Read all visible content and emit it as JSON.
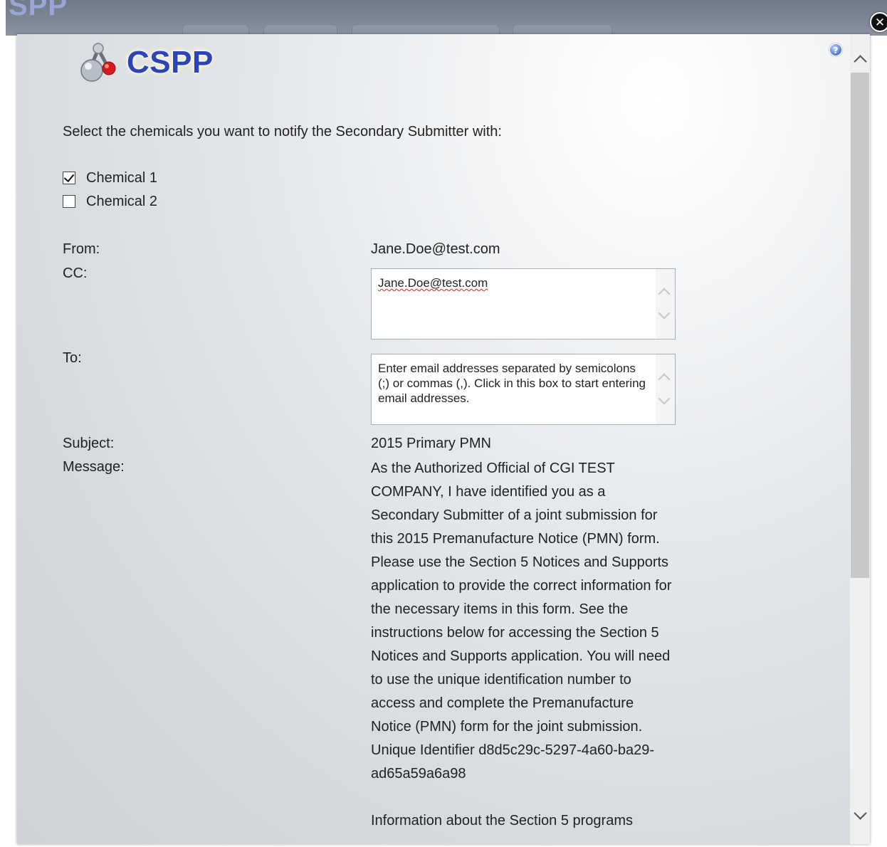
{
  "background_app": {
    "logo_text": "SPP"
  },
  "dialog": {
    "logo_text": "CSPP",
    "instruction": "Select the chemicals you want to notify the Secondary Submitter with:",
    "chemicals": [
      {
        "label": "Chemical 1",
        "checked": true
      },
      {
        "label": "Chemical 2",
        "checked": false
      }
    ],
    "from_label": "From:",
    "from_value": "Jane.Doe@test.com",
    "cc_label": "CC:",
    "cc_value": "Jane.Doe@test.com",
    "to_label": "To:",
    "to_placeholder": "Enter email addresses separated by semicolons (;) or commas (,). Click in this box to start entering email addresses.",
    "subject_label": "Subject:",
    "subject_value": "2015 Primary PMN",
    "message_label": "Message:",
    "message_body": "As the Authorized Official of CGI TEST COMPANY, I have identified you as a Secondary Submitter of a joint submission for this 2015 Premanufacture Notice (PMN) form. Please use the Section 5 Notices and Supports application to provide the correct information for the necessary items in this form. See the instructions below for accessing the Section 5 Notices and Supports application. You will need to use the unique identification number to access and complete the Premanufacture Notice (PMN) form for the joint submission.",
    "unique_identifier": "Unique Identifier d8d5c29c-5297-4a60-ba29-ad65a59a6a98",
    "message_continuation": "Information about the Section 5 programs"
  },
  "icons": {
    "close": "close-icon",
    "help": "help-icon",
    "logo": "molecule-logo-icon"
  }
}
